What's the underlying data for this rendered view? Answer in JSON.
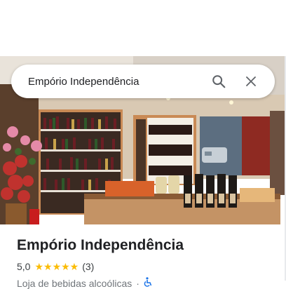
{
  "search": {
    "value": "Empório Independência",
    "search_icon": "search-icon",
    "close_icon": "close-icon"
  },
  "place": {
    "title": "Empório Independência",
    "rating": "5,0",
    "stars": "★★★★★",
    "review_count": "(3)",
    "category": "Loja de bebidas alcoólicas",
    "separator": "·",
    "accessibility_icon": "wheelchair-icon"
  },
  "colors": {
    "star": "#fbbc04",
    "text_primary": "#202124",
    "accent": "#1a73e8"
  }
}
